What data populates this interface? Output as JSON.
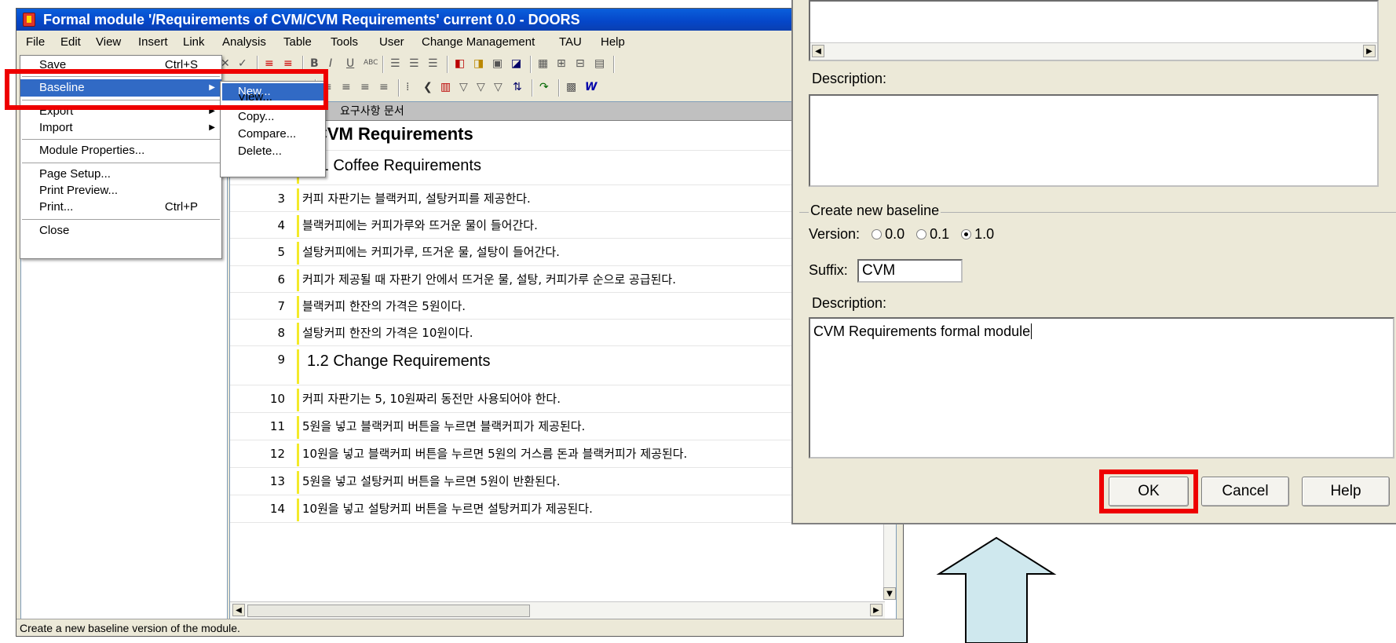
{
  "window": {
    "title": "Formal module '/Requirements of CVM/CVM Requirements' current 0.0 - DOORS",
    "status": "Create a new baseline version of the module."
  },
  "menubar": [
    "File",
    "Edit",
    "View",
    "Insert",
    "Link",
    "Analysis",
    "Table",
    "Tools",
    "User",
    "Change Management",
    "TAU",
    "Help"
  ],
  "file_menu": {
    "save": "Save",
    "save_shortcut": "Ctrl+S",
    "baseline": "Baseline",
    "export": "Export",
    "import": "Import",
    "module_properties": "Module Properties...",
    "page_setup": "Page Setup...",
    "print_preview": "Print Preview...",
    "print": "Print...",
    "print_shortcut": "Ctrl+P",
    "close": "Close"
  },
  "baseline_submenu": {
    "new": "New...",
    "view": "View...",
    "copy": "Copy...",
    "compare": "Compare...",
    "delete": "Delete..."
  },
  "document": {
    "header": "요구사항 문서",
    "rows": [
      {
        "num": "",
        "text": "CVM Requirements"
      },
      {
        "num": "2",
        "text": "1.1 Coffee Requirements"
      },
      {
        "num": "3",
        "text": "커피 자판기는 블랙커피, 설탕커피를 제공한다."
      },
      {
        "num": "4",
        "text": "블랙커피에는 커피가루와 뜨거운 물이 들어간다."
      },
      {
        "num": "5",
        "text": "설탕커피에는 커피가루, 뜨거운 물, 설탕이 들어간다."
      },
      {
        "num": "6",
        "text": "커피가 제공될 때 자판기 안에서 뜨거운 물, 설탕, 커피가루 순으로 공급된다."
      },
      {
        "num": "7",
        "text": "블랙커피 한잔의 가격은 5원이다."
      },
      {
        "num": "8",
        "text": "설탕커피 한잔의 가격은 10원이다."
      },
      {
        "num": "9",
        "text": "1.2 Change Requirements"
      },
      {
        "num": "10",
        "text": "커피 자판기는 5, 10원짜리 동전만 사용되어야 한다."
      },
      {
        "num": "11",
        "text": "5원을 넣고 블랙커피 버튼을 누르면 블랙커피가 제공된다."
      },
      {
        "num": "12",
        "text": "10원을 넣고 블랙커피 버튼을 누르면 5원의 거스름 돈과 블랙커피가 제공된다."
      },
      {
        "num": "13",
        "text": "5원을 넣고 설탕커피 버튼을 누르면 5원이 반환된다."
      },
      {
        "num": "14",
        "text": "10원을 넣고 설탕커피 버튼을 누르면 설탕커피가 제공된다."
      }
    ]
  },
  "dialog": {
    "description_label": "Description:",
    "group_title": "Create new baseline",
    "version_label": "Version:",
    "versions": [
      "0.0",
      "0.1",
      "1.0"
    ],
    "selected_version": "1.0",
    "suffix_label": "Suffix:",
    "suffix_value": "CVM",
    "description2_label": "Description:",
    "description2_value": "CVM Requirements formal module",
    "ok": "OK",
    "cancel": "Cancel",
    "help": "Help"
  },
  "colors": {
    "highlight": "#ee0000",
    "selection": "#316ac5",
    "arrow_fill": "#cfe8ee",
    "title_bar": "#0546c8"
  }
}
